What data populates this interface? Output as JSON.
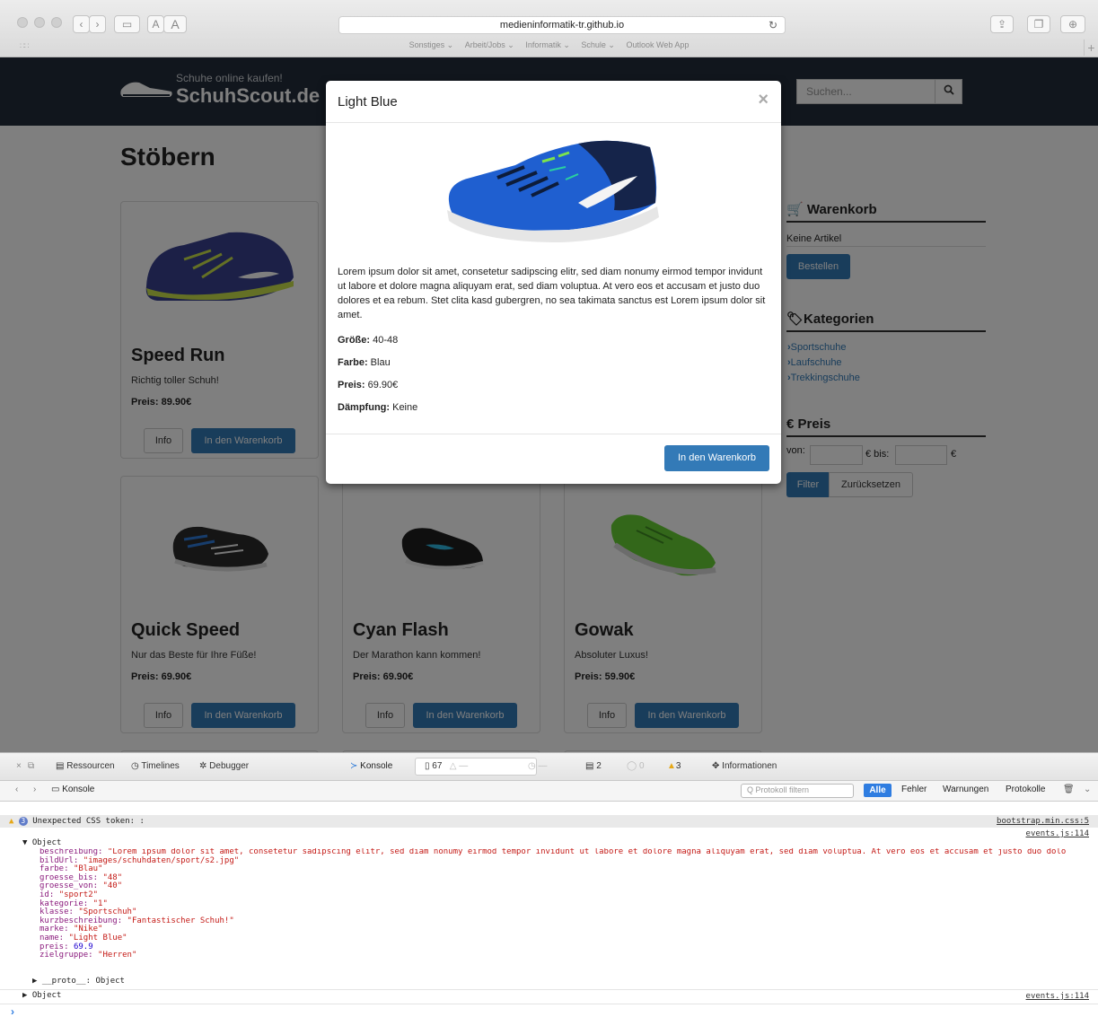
{
  "browser": {
    "url": "medieninformatik-tr.github.io",
    "bookmarks": [
      "Sonstiges ⌄",
      "Arbeit/Jobs ⌄",
      "Informatik ⌄",
      "Schule ⌄",
      "Outlook Web App"
    ],
    "font_small": "A",
    "font_large": "A"
  },
  "site": {
    "logo_tagline": "Schuhe online kaufen!",
    "logo_name": "SchuhScout.de",
    "search_placeholder": "Suchen...",
    "page_title": "Stöbern"
  },
  "products": [
    {
      "name": "Speed Run",
      "desc": "Richtig toller Schuh!",
      "price": "Preis: 89.90€",
      "info": "Info",
      "cart": "In den Warenkorb",
      "color": "#3a3f8a"
    },
    {
      "name": "Quick Speed",
      "desc": "Nur das Beste für Ihre Füße!",
      "price": "Preis: 69.90€",
      "info": "Info",
      "cart": "In den Warenkorb",
      "color": "#2a2a2a"
    },
    {
      "name": "Cyan Flash",
      "desc": "Der Marathon kann kommen!",
      "price": "Preis: 69.90€",
      "info": "Info",
      "cart": "In den Warenkorb",
      "color": "#1f1f1f"
    },
    {
      "name": "Gowak",
      "desc": "Absoluter Luxus!",
      "price": "Preis: 59.90€",
      "info": "Info",
      "cart": "In den Warenkorb",
      "color": "#6ad13a"
    }
  ],
  "sidebar": {
    "cart_title": "Warenkorb",
    "cart_empty": "Keine Artikel",
    "order_btn": "Bestellen",
    "cat_title": "Kategorien",
    "categories": [
      "Sportschuhe",
      "Laufschuhe",
      "Trekkingschuhe"
    ],
    "price_title": "€ Preis",
    "price_from": "von:",
    "price_to": "€ bis:",
    "currency": "€",
    "filter_btn": "Filter",
    "reset_btn": "Zurücksetzen"
  },
  "modal": {
    "title": "Light Blue",
    "close": "×",
    "description": "Lorem ipsum dolor sit amet, consetetur sadipscing elitr, sed diam nonumy eirmod tempor invidunt ut labore et dolore magna aliquyam erat, sed diam voluptua. At vero eos et accusam et justo duo dolores et ea rebum. Stet clita kasd gubergren, no sea takimata sanctus est Lorem ipsum dolor sit amet.",
    "size_label": "Größe:",
    "size_value": " 40-48",
    "color_label": "Farbe:",
    "color_value": " Blau",
    "price_label": "Preis:",
    "price_value": " 69.90€",
    "damping_label": "Dämpfung:",
    "damping_value": " Keine",
    "cart_btn": "In den Warenkorb"
  },
  "devtools": {
    "tabs": [
      "Ressourcen",
      "Timelines",
      "Debugger",
      "Konsole",
      "Informationen"
    ],
    "count_docs": "67",
    "count_dash1": "—",
    "count_dash2": "—",
    "count_logs": "2",
    "count_errors": "0",
    "count_warnings": "3",
    "console_label": "Konsole",
    "filter_placeholder": "Protokoll filtern",
    "filters": [
      "Alle",
      "Fehler",
      "Warnungen",
      "Protokolle"
    ],
    "warning_badge": "3",
    "warning_text": "Unexpected CSS token: :",
    "warning_src": "bootstrap.min.css:5",
    "obj_src": "events.js:114",
    "obj_header": "▼ Object",
    "obj2_header": "▶ Object",
    "proto_line": "▶ __proto__: Object",
    "props": [
      {
        "k": "beschreibung",
        "v": "\"Lorem ipsum dolor sit amet, consetetur sadipscing elitr, sed diam nonumy eirmod tempor invidunt ut labore et dolore magna aliquyam erat, sed diam voluptua. At vero eos et accusam et justo duo dolo",
        "t": "s"
      },
      {
        "k": "bildUrl",
        "v": "\"images/schuhdaten/sport/s2.jpg\"",
        "t": "s"
      },
      {
        "k": "farbe",
        "v": "\"Blau\"",
        "t": "s"
      },
      {
        "k": "groesse_bis",
        "v": "\"48\"",
        "t": "s"
      },
      {
        "k": "groesse_von",
        "v": "\"40\"",
        "t": "s"
      },
      {
        "k": "id",
        "v": "\"sport2\"",
        "t": "s"
      },
      {
        "k": "kategorie",
        "v": "\"1\"",
        "t": "s"
      },
      {
        "k": "klasse",
        "v": "\"Sportschuh\"",
        "t": "s"
      },
      {
        "k": "kurzbeschreibung",
        "v": "\"Fantastischer Schuh!\"",
        "t": "s"
      },
      {
        "k": "marke",
        "v": "\"Nike\"",
        "t": "s"
      },
      {
        "k": "name",
        "v": "\"Light Blue\"",
        "t": "s"
      },
      {
        "k": "preis",
        "v": "69.9",
        "t": "n"
      },
      {
        "k": "zielgruppe",
        "v": "\"Herren\"",
        "t": "s"
      }
    ],
    "prompt": "›"
  }
}
